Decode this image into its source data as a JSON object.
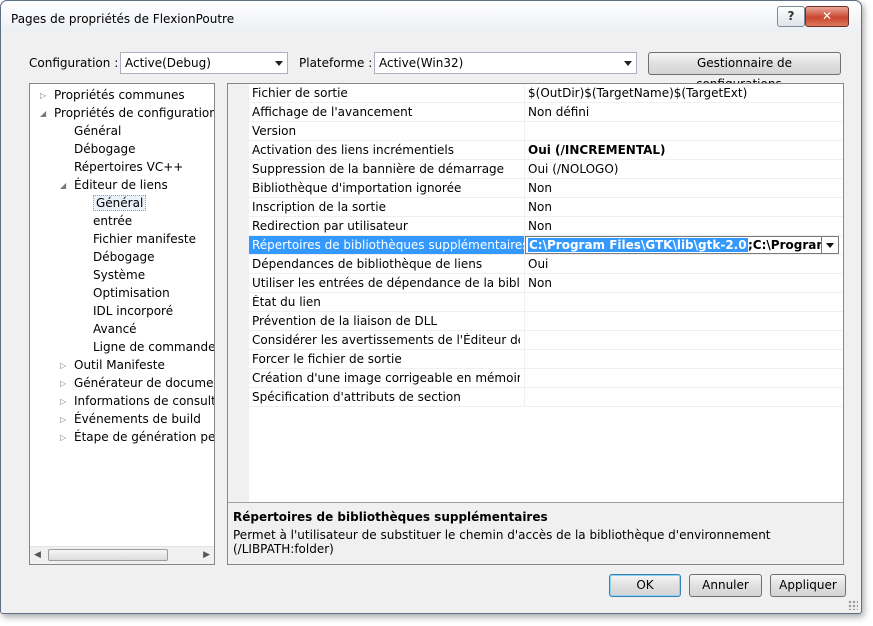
{
  "window": {
    "title": "Pages de propriétés de FlexionPoutre",
    "help_label": "?",
    "close_label": "✕"
  },
  "toolbar": {
    "configuration_label": "Configuration :",
    "configuration_value": "Active(Debug)",
    "platform_label": "Plateforme :",
    "platform_value": "Active(Win32)",
    "config_manager_label": "Gestionnaire de configurations..."
  },
  "tree": {
    "items": [
      {
        "label": "Propriétés communes",
        "level": 0,
        "expander": "▷"
      },
      {
        "label": "Propriétés de configuration",
        "level": 0,
        "expander": "◢"
      },
      {
        "label": "Général",
        "level": 1,
        "expander": ""
      },
      {
        "label": "Débogage",
        "level": 1,
        "expander": ""
      },
      {
        "label": "Répertoires VC++",
        "level": 1,
        "expander": ""
      },
      {
        "label": "Éditeur de liens",
        "level": 1,
        "expander": "◢"
      },
      {
        "label": "Général",
        "level": 2,
        "expander": "",
        "selected": true
      },
      {
        "label": "entrée",
        "level": 2,
        "expander": ""
      },
      {
        "label": "Fichier manifeste",
        "level": 2,
        "expander": ""
      },
      {
        "label": "Débogage",
        "level": 2,
        "expander": ""
      },
      {
        "label": "Système",
        "level": 2,
        "expander": ""
      },
      {
        "label": "Optimisation",
        "level": 2,
        "expander": ""
      },
      {
        "label": "IDL incorporé",
        "level": 2,
        "expander": ""
      },
      {
        "label": "Avancé",
        "level": 2,
        "expander": ""
      },
      {
        "label": "Ligne de commande",
        "level": 2,
        "expander": ""
      },
      {
        "label": "Outil Manifeste",
        "level": 1,
        "expander": "▷"
      },
      {
        "label": "Générateur de document XML",
        "level": 1,
        "expander": "▷"
      },
      {
        "label": "Informations de consultation",
        "level": 1,
        "expander": "▷"
      },
      {
        "label": "Événements de build",
        "level": 1,
        "expander": "▷"
      },
      {
        "label": "Étape de génération personnalisée",
        "level": 1,
        "expander": "▷"
      }
    ],
    "scroll_left": "◀",
    "scroll_right": "▶"
  },
  "properties": {
    "rows": [
      {
        "name": "Fichier de sortie",
        "value": "$(OutDir)$(TargetName)$(TargetExt)"
      },
      {
        "name": "Affichage de l'avancement",
        "value": "Non défini"
      },
      {
        "name": "Version",
        "value": ""
      },
      {
        "name": "Activation des liens incrémentiels",
        "value": "Oui (/INCREMENTAL)",
        "bold": true
      },
      {
        "name": "Suppression de la bannière de démarrage",
        "value": "Oui (/NOLOGO)"
      },
      {
        "name": "Bibliothèque d'importation ignorée",
        "value": "Non"
      },
      {
        "name": "Inscription de la sortie",
        "value": "Non"
      },
      {
        "name": "Redirection par utilisateur",
        "value": "Non"
      },
      {
        "name": "Répertoires de bibliothèques supplémentaires",
        "value": "",
        "selected": true
      },
      {
        "name": "Dépendances de bibliothèque de liens",
        "value": "Oui"
      },
      {
        "name": "Utiliser les entrées de dépendance de la bibliothèque",
        "value": "Non"
      },
      {
        "name": "État du lien",
        "value": ""
      },
      {
        "name": "Prévention de la liaison de DLL",
        "value": ""
      },
      {
        "name": "Considérer les avertissements de l'Éditeur de liens comme des erreurs",
        "value": ""
      },
      {
        "name": "Forcer le fichier de sortie",
        "value": ""
      },
      {
        "name": "Création d'une image corrigeable en mémoire",
        "value": ""
      },
      {
        "name": "Spécification d'attributs de section",
        "value": ""
      }
    ],
    "edit_value_highlight": "C:\\Program Files\\GTK\\lib\\gtk-2.0",
    "edit_value_rest": ";C:\\Program Files\\GTK\\lib"
  },
  "description": {
    "title": "Répertoires de bibliothèques supplémentaires",
    "text": "Permet à l'utilisateur de substituer le chemin d'accès de la bibliothèque d'environnement (/LIBPATH:folder)"
  },
  "buttons": {
    "ok": "OK",
    "cancel": "Annuler",
    "apply": "Appliquer"
  }
}
